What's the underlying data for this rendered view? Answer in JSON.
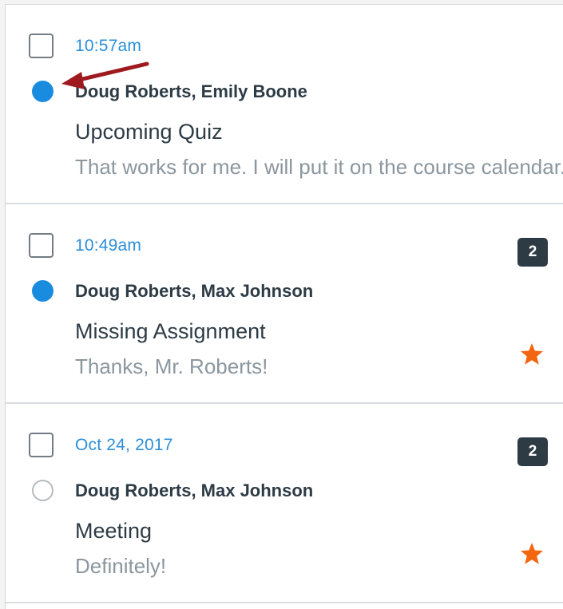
{
  "conversations": [
    {
      "date": "10:57am",
      "participants": "Doug Roberts, Emily Boone",
      "subject": "Upcoming Quiz",
      "preview": "That works for me. I will put it on the course calendar.",
      "unread": true,
      "message_count": null,
      "starred": false
    },
    {
      "date": "10:49am",
      "participants": "Doug Roberts, Max Johnson",
      "subject": "Missing Assignment",
      "preview": "Thanks, Mr. Roberts!",
      "unread": true,
      "message_count": "2",
      "starred": true
    },
    {
      "date": "Oct 24, 2017",
      "participants": "Doug Roberts, Max Johnson",
      "subject": "Meeting",
      "preview": "Definitely!",
      "unread": false,
      "message_count": "2",
      "starred": true
    }
  ],
  "colors": {
    "accent": "#2b8fd9",
    "unread_dot": "#1a8ce0",
    "badge": "#2d3b45",
    "star": "#f4650f",
    "annotation_arrow": "#9e1a1e"
  },
  "icons": {
    "star": "star-icon",
    "annotation": "callout-arrow-icon"
  }
}
